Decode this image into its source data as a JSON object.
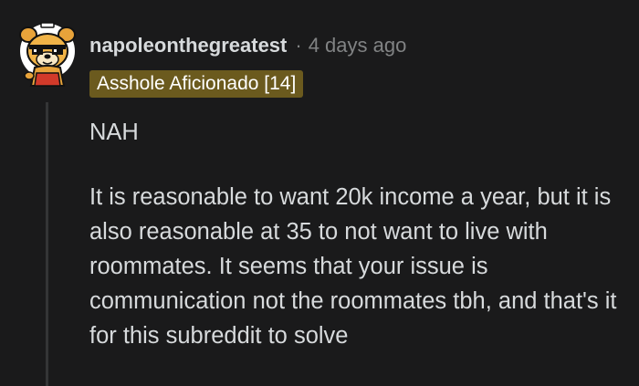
{
  "comment": {
    "author": "napoleonthegreatest",
    "separator": "·",
    "timestamp": "4 days ago",
    "flair": "Asshole Aficionado [14]",
    "paragraphs": [
      "NAH",
      "It is reasonable to want 20k income a year, but it is also reasonable at 35 to not want to live with roommates. It seems that your issue is communication not the roommates tbh, and that's it for this subreddit to solve"
    ],
    "avatar_icon": "cartoon-dog-avatar-icon"
  },
  "colors": {
    "background": "#1a1a1b",
    "text": "#d7dadc",
    "meta_text": "#818384",
    "flair_bg": "#6b5a1e",
    "flair_text": "#ffffff",
    "thread_line": "#343536"
  }
}
